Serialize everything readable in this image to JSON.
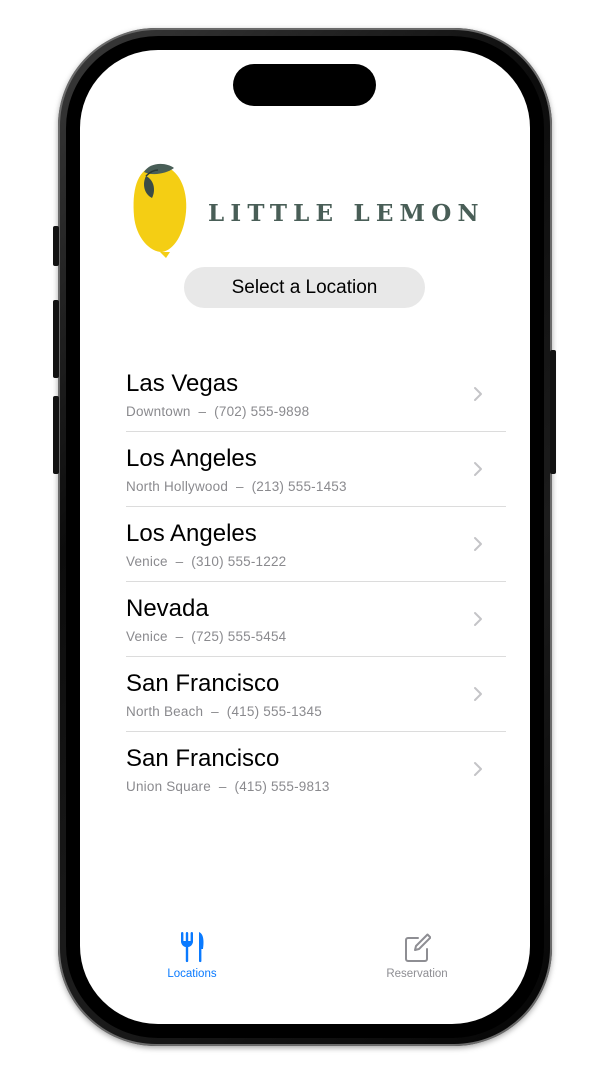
{
  "app": {
    "brand_name": "LITTLE LEMON",
    "brand_colors": {
      "lemon": "#f4ce14",
      "leaf": "#495e57",
      "accent": "#0a7aff"
    }
  },
  "header": {
    "select_label": "Select a Location"
  },
  "locations": [
    {
      "city": "Las Vegas",
      "neighborhood": "Downtown",
      "phone": "(702) 555-9898"
    },
    {
      "city": "Los Angeles",
      "neighborhood": "North Hollywood",
      "phone": "(213) 555-1453"
    },
    {
      "city": "Los Angeles",
      "neighborhood": "Venice",
      "phone": "(310) 555-1222"
    },
    {
      "city": "Nevada",
      "neighborhood": "Venice",
      "phone": "(725) 555-5454"
    },
    {
      "city": "San Francisco",
      "neighborhood": "North Beach",
      "phone": "(415) 555-1345"
    },
    {
      "city": "San Francisco",
      "neighborhood": "Union Square",
      "phone": "(415) 555-9813"
    }
  ],
  "separator": "–",
  "tab_bar": {
    "items": [
      {
        "label": "Locations",
        "icon": "fork-knife-icon",
        "selected": true
      },
      {
        "label": "Reservation",
        "icon": "square-pencil-icon",
        "selected": false
      }
    ]
  }
}
